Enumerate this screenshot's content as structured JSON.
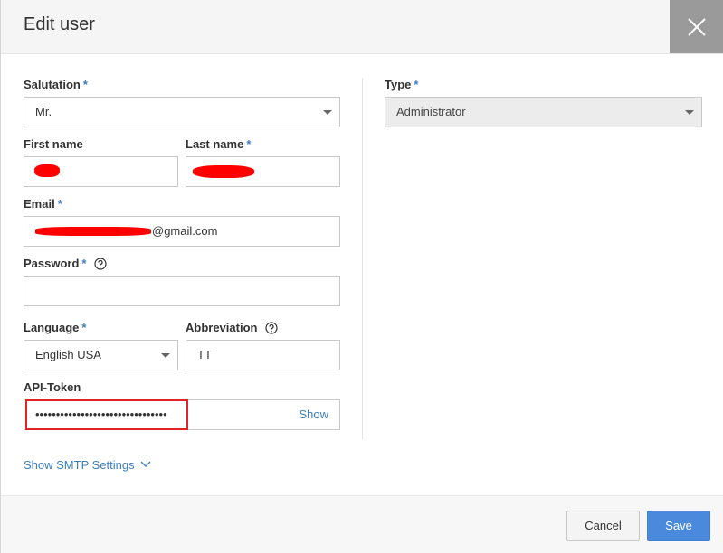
{
  "dialog": {
    "title": "Edit user"
  },
  "form": {
    "salutation": {
      "label": "Salutation",
      "required": "*",
      "value": "Mr."
    },
    "first_name": {
      "label": "First name",
      "value": ""
    },
    "last_name": {
      "label": "Last name",
      "required": "*",
      "value": ""
    },
    "email": {
      "label": "Email",
      "required": "*",
      "value": "@gmail.com"
    },
    "password": {
      "label": "Password",
      "required": "*",
      "value": ""
    },
    "language": {
      "label": "Language",
      "required": "*",
      "value": "English USA"
    },
    "abbreviation": {
      "label": "Abbreviation",
      "value": "TT"
    },
    "api_token": {
      "label": "API-Token",
      "value": "••••••••••••••••••••••••••••••••",
      "show_label": "Show"
    },
    "type": {
      "label": "Type",
      "required": "*",
      "value": "Administrator"
    }
  },
  "smtp_link": {
    "label": "Show SMTP Settings"
  },
  "footer": {
    "cancel_label": "Cancel",
    "save_label": "Save"
  },
  "colors": {
    "accent": "#3a7fc1",
    "primary_button": "#4a89dc",
    "highlight": "#e32323",
    "close_bg": "#9a9a9a"
  },
  "icons": {
    "close": "close-icon",
    "help": "help-icon",
    "caret": "caret-down-icon",
    "chevron": "chevron-down-icon"
  }
}
